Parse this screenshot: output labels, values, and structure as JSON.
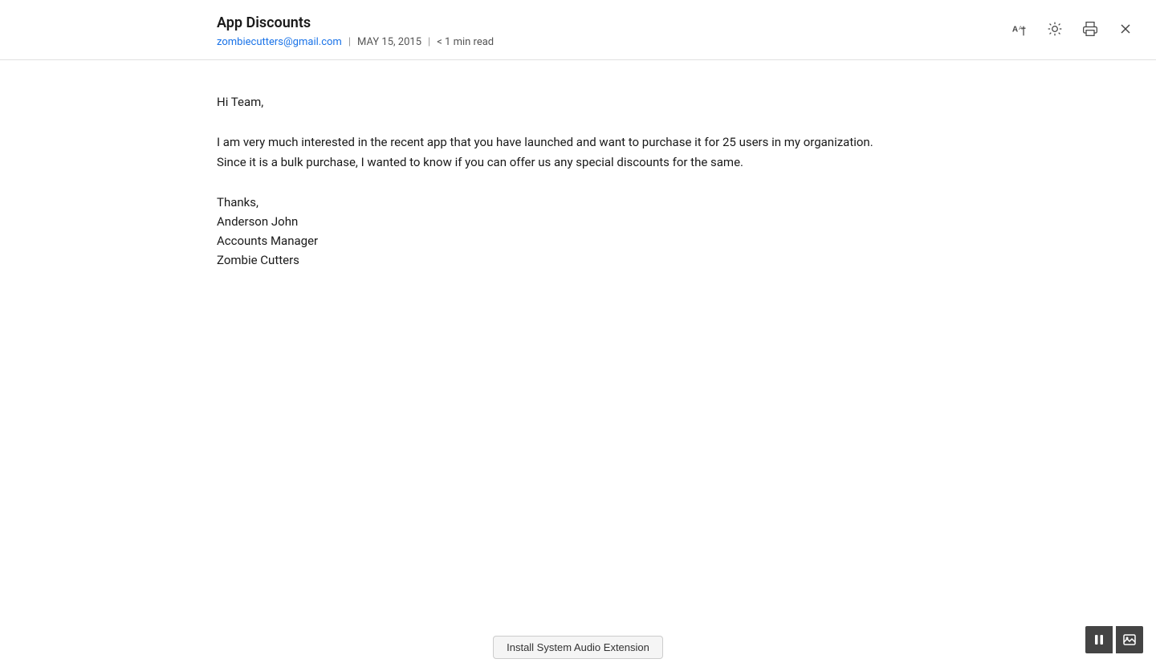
{
  "email": {
    "subject": "App Discounts",
    "sender_email": "zombiecutters@gmail.com",
    "date": "MAY 15, 2015",
    "read_time": "< 1 min read",
    "separator": "|",
    "greeting": "Hi Team,",
    "body_paragraph": "I am very much interested in the recent app that you have launched and want to purchase it for 25 users in my organization. Since it is a bulk purchase, I wanted to know if you can offer us any special discounts for the same.",
    "sign_off": "Thanks,",
    "sender_name": "Anderson John",
    "sender_title": "Accounts Manager",
    "sender_company": "Zombie Cutters"
  },
  "toolbar": {
    "font_size_icon": "A↑",
    "brightness_icon": "☀",
    "print_icon": "🖶",
    "close_icon": "✕"
  },
  "bottom_bar": {
    "install_button_label": "Install System Audio Extension"
  },
  "bottom_controls": {
    "pause_icon": "⏸",
    "image_icon": "🖼"
  }
}
